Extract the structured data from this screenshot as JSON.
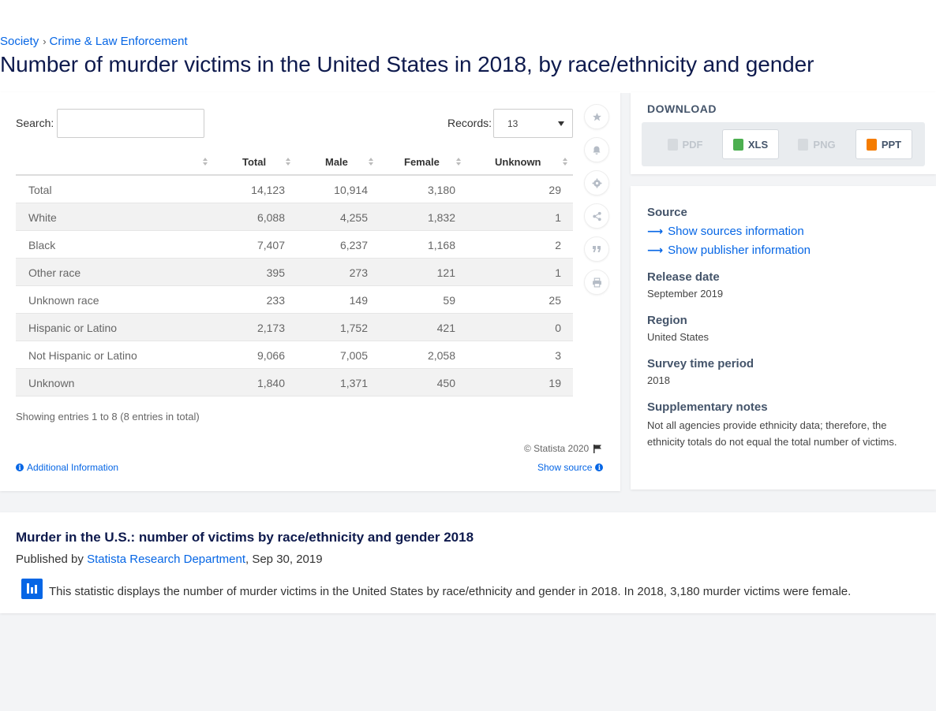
{
  "breadcrumb": [
    "Society",
    "Crime & Law Enforcement"
  ],
  "page_title": "Number of murder victims in the United States in 2018, by race/ethnicity and gender",
  "search": {
    "label": "Search:",
    "value": ""
  },
  "records": {
    "label": "Records:",
    "value": "13"
  },
  "table": {
    "columns": [
      "",
      "Total",
      "Male",
      "Female",
      "Unknown"
    ],
    "rows": [
      [
        "Total",
        "14,123",
        "10,914",
        "3,180",
        "29"
      ],
      [
        "White",
        "6,088",
        "4,255",
        "1,832",
        "1"
      ],
      [
        "Black",
        "7,407",
        "6,237",
        "1,168",
        "2"
      ],
      [
        "Other race",
        "395",
        "273",
        "121",
        "1"
      ],
      [
        "Unknown race",
        "233",
        "149",
        "59",
        "25"
      ],
      [
        "Hispanic or Latino",
        "2,173",
        "1,752",
        "421",
        "0"
      ],
      [
        "Not Hispanic or Latino",
        "9,066",
        "7,005",
        "2,058",
        "3"
      ],
      [
        "Unknown",
        "1,840",
        "1,371",
        "450",
        "19"
      ]
    ]
  },
  "entries_text": "Showing entries 1 to 8 (8 entries in total)",
  "copyright": "© Statista 2020",
  "additional_info": "Additional Information",
  "show_source": "Show source",
  "toolbar_icons": [
    "star-icon",
    "bell-icon",
    "gear-icon",
    "share-icon",
    "quote-icon",
    "print-icon"
  ],
  "download": {
    "title": "DOWNLOAD",
    "buttons": [
      {
        "label": "PDF",
        "enabled": false
      },
      {
        "label": "XLS",
        "enabled": true
      },
      {
        "label": "PNG",
        "enabled": false
      },
      {
        "label": "PPT",
        "enabled": true
      }
    ]
  },
  "info": {
    "source_label": "Source",
    "show_sources": "Show sources information",
    "show_publisher": "Show publisher information",
    "release_label": "Release date",
    "release_value": "September 2019",
    "region_label": "Region",
    "region_value": "United States",
    "survey_label": "Survey time period",
    "survey_value": "2018",
    "notes_label": "Supplementary notes",
    "notes_value": "Not all agencies provide ethnicity data; therefore, the ethnicity totals do not equal the total number of victims."
  },
  "description": {
    "title": "Murder in the U.S.: number of victims by race/ethnicity and gender 2018",
    "published_prefix": "Published by",
    "publisher": "Statista Research Department",
    "date": ", Sep 30, 2019",
    "text": "This statistic displays the number of murder victims in the United States by race/ethnicity and gender in 2018. In 2018, 3,180 murder victims were female."
  },
  "colors": {
    "link": "#0666e5",
    "title": "#0e1a4d",
    "xls": "#4caf50",
    "ppt": "#f57c00"
  }
}
